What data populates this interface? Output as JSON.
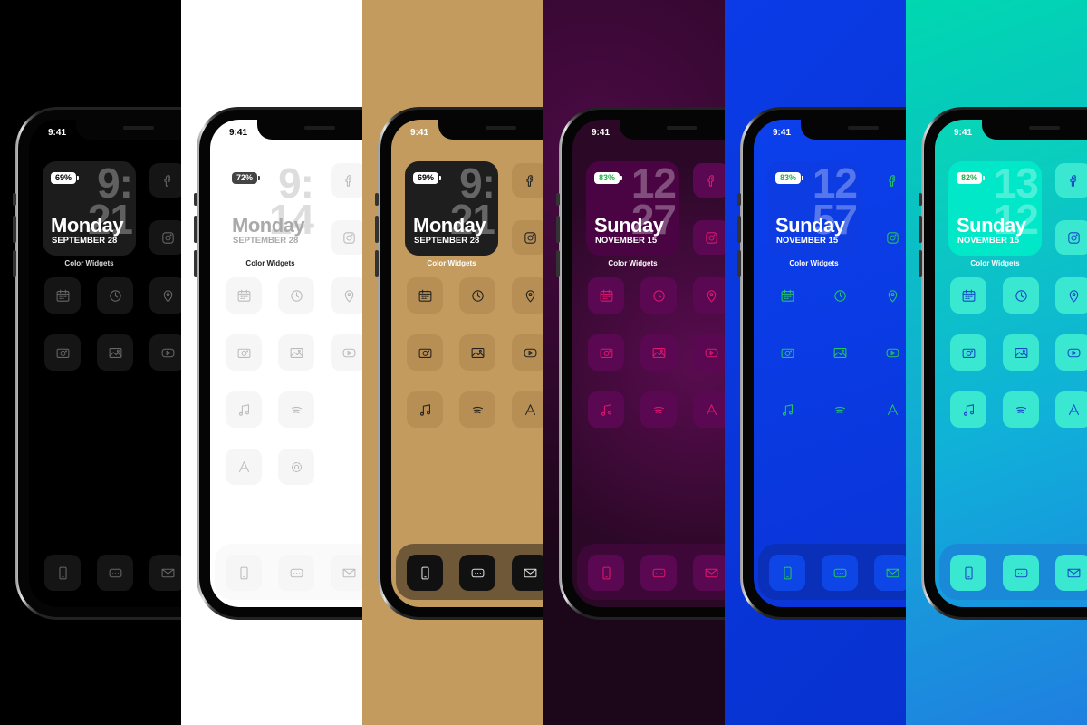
{
  "status_time": "9:41",
  "widget_label": "Color Widgets",
  "panels": [
    {
      "theme": "black",
      "battery": "69%",
      "clock": [
        "9:",
        "21"
      ],
      "day": "Monday",
      "date": "SEPTEMBER 28",
      "colors": {
        "bg": "#000000",
        "screen": "#000000",
        "widget": "#1c1c1c",
        "bigt": "rgba(255,255,255,0.3)",
        "day": "#ffffff",
        "tile": "#151515",
        "icon": "#666666",
        "label": "#dddddd",
        "stime": "#ffffff",
        "batt_bg": "#ffffff",
        "batt_fg": "#000000",
        "dock": "transparent",
        "dock_tile": "#151515",
        "dock_icon": "#666666"
      },
      "rows": [
        [
          "calendar",
          "clock",
          "map"
        ],
        [
          "camera",
          "photos",
          "youtube"
        ]
      ],
      "side": [
        "facebook",
        "instagram"
      ],
      "dock": [
        "phone",
        "messages",
        "mail"
      ]
    },
    {
      "theme": "white",
      "battery": "72%",
      "clock": [
        "9:",
        "14"
      ],
      "day": "Monday",
      "date": "SEPTEMBER 28",
      "colors": {
        "bg": "#ffffff",
        "screen": "#ffffff",
        "widget": "#ffffff",
        "bigt": "#dddddd",
        "day": "#aaaaaa",
        "tile": "#f6f6f6",
        "icon": "#bbbbbb",
        "label": "#222222",
        "stime": "#000000",
        "batt_bg": "#444444",
        "batt_fg": "#ffffff",
        "dock": "#fafafa",
        "dock_tile": "#f6f6f6",
        "dock_icon": "#bbbbbb"
      },
      "rows": [
        [
          "calendar",
          "clock",
          "map"
        ],
        [
          "camera",
          "photos",
          "youtube"
        ],
        [
          "music",
          "spotify",
          ""
        ],
        [
          "appstore",
          "settings",
          ""
        ]
      ],
      "side": [
        "facebook",
        "instagram"
      ],
      "dock": [
        "phone",
        "messages",
        "mail"
      ]
    },
    {
      "theme": "gold",
      "battery": "69%",
      "clock": [
        "9:",
        "21"
      ],
      "day": "Monday",
      "date": "SEPTEMBER 28",
      "colors": {
        "bg": "#c49b5e",
        "screen": "#c49b5e",
        "widget": "#1e1e1e",
        "bigt": "#666666",
        "day": "#ffffff",
        "tile": "#b78f55",
        "icon": "#222222",
        "label": "#ffffff",
        "stime": "#ffffff",
        "batt_bg": "#ffffff",
        "batt_fg": "#000000",
        "dock": "#6e5838",
        "dock_tile": "#111111",
        "dock_icon": "#dddddd"
      },
      "rows": [
        [
          "calendar",
          "clock",
          "map"
        ],
        [
          "camera",
          "photos",
          "youtube"
        ],
        [
          "music",
          "spotify",
          "appstore"
        ]
      ],
      "side": [
        "facebook",
        "instagram"
      ],
      "dock": [
        "phone",
        "messages",
        "mail"
      ]
    },
    {
      "theme": "purple",
      "battery": "83%",
      "clock": [
        "12",
        "27"
      ],
      "day": "Sunday",
      "date": "NOVEMBER 15",
      "colors": {
        "bg": "#2e0a2a",
        "screen": "#320a2e",
        "widget": "#4a0444",
        "bigt": "rgba(255,255,255,0.3)",
        "day": "#ffffff",
        "tile": "#5a0852",
        "icon": "#e0156e",
        "label": "#ffffff",
        "stime": "#ffffff",
        "batt_bg": "#ffffff",
        "batt_fg": "#22b04b",
        "dock": "#3d0838",
        "dock_tile": "#5a0852",
        "dock_icon": "#e0156e"
      },
      "rows": [
        [
          "calendar",
          "clock",
          "map"
        ],
        [
          "camera",
          "photos",
          "youtube"
        ],
        [
          "music",
          "spotify",
          "appstore"
        ]
      ],
      "side": [
        "facebook",
        "instagram"
      ],
      "dock": [
        "phone",
        "messages",
        "mail"
      ]
    },
    {
      "theme": "blue",
      "battery": "83%",
      "clock": [
        "12",
        "57"
      ],
      "day": "Sunday",
      "date": "NOVEMBER 15",
      "colors": {
        "bg": "#0a3be6",
        "screen": "#0b3ae6",
        "widget": "#0d3de2",
        "bigt": "rgba(255,255,255,0.3)",
        "day": "#ffffff",
        "tile": "transparent",
        "icon": "#22c55e",
        "label": "#ffffff",
        "stime": "#ffffff",
        "batt_bg": "#ffffff",
        "batt_fg": "#22b04b",
        "dock": "#0a2fb8",
        "dock_tile": "#0d45e6",
        "dock_icon": "#22c55e"
      },
      "rows": [
        [
          "calendar",
          "clock",
          "map"
        ],
        [
          "camera",
          "photos",
          "youtube"
        ],
        [
          "music",
          "spotify",
          "appstore"
        ]
      ],
      "side": [
        "facebook",
        "instagram"
      ],
      "dock": [
        "phone",
        "messages",
        "mail"
      ]
    },
    {
      "theme": "teal",
      "battery": "82%",
      "clock": [
        "13",
        "12"
      ],
      "day": "Sunday",
      "date": "NOVEMBER 15",
      "colors": {
        "bg": "#0bb8c8",
        "screen": "#10b4d2",
        "widget": "#00e8c8",
        "bigt": "rgba(255,255,255,0.3)",
        "day": "#ffffff",
        "tile": "#3ae8d2",
        "icon": "#1746c8",
        "label": "#ffffff",
        "stime": "#ffffff",
        "batt_bg": "#ffffff",
        "batt_fg": "#22b04b",
        "dock": "#1a8ad8",
        "dock_tile": "#3ae8d2",
        "dock_icon": "#1746c8"
      },
      "rows": [
        [
          "calendar",
          "clock",
          "map"
        ],
        [
          "camera",
          "photos",
          "youtube"
        ],
        [
          "music",
          "spotify",
          "appstore"
        ]
      ],
      "side": [
        "facebook",
        "instagram"
      ],
      "dock": [
        "phone",
        "messages",
        "mail"
      ]
    }
  ]
}
